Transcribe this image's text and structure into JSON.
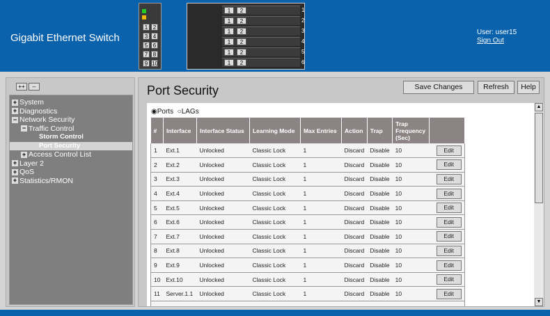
{
  "header": {
    "title": "Gigabit Ethernet Switch",
    "user_label": "User: user15",
    "sign_out": "Sign Out",
    "switch_ports": [
      "1",
      "2",
      "3",
      "4",
      "5",
      "6",
      "7",
      "8",
      "9",
      "10"
    ],
    "blade_slots": [
      {
        "p1": "1",
        "p2": "2",
        "num": "1"
      },
      {
        "p1": "1",
        "p2": "2",
        "num": "2"
      },
      {
        "p1": "1",
        "p2": "2",
        "num": "3"
      },
      {
        "p1": "1",
        "p2": "2",
        "num": "4"
      },
      {
        "p1": "1",
        "p2": "2",
        "num": "5"
      },
      {
        "p1": "1",
        "p2": "2",
        "num": "6"
      }
    ]
  },
  "sidebar": {
    "expand_all": "++",
    "collapse_all": "--",
    "items": [
      {
        "label": "System",
        "box": "+"
      },
      {
        "label": "Diagnostics",
        "box": "+"
      },
      {
        "label": "Network Security",
        "box": "−"
      },
      {
        "label": "Traffic Control",
        "box": "−"
      },
      {
        "label": "Storm Control"
      },
      {
        "label": "Port Security"
      },
      {
        "label": "Access Control List",
        "box": "+"
      },
      {
        "label": "Layer 2",
        "box": "+"
      },
      {
        "label": "QoS",
        "box": "+"
      },
      {
        "label": "Statistics/RMON",
        "box": "+"
      }
    ]
  },
  "main": {
    "title": "Port Security",
    "save": "Save Changes",
    "refresh": "Refresh",
    "help": "Help",
    "radio_ports": "Ports",
    "radio_lags": "LAGs",
    "columns": [
      "#",
      "Interface",
      "Interface Status",
      "Learning Mode",
      "Max Entries",
      "Action",
      "Trap",
      "Trap Frequency (Sec)",
      ""
    ],
    "edit_label": "Edit",
    "rows": [
      [
        "1",
        "Ext.1",
        "Unlocked",
        "Classic Lock",
        "1",
        "Discard",
        "Disable",
        "10"
      ],
      [
        "2",
        "Ext.2",
        "Unlocked",
        "Classic Lock",
        "1",
        "Discard",
        "Disable",
        "10"
      ],
      [
        "3",
        "Ext.3",
        "Unlocked",
        "Classic Lock",
        "1",
        "Discard",
        "Disable",
        "10"
      ],
      [
        "4",
        "Ext.4",
        "Unlocked",
        "Classic Lock",
        "1",
        "Discard",
        "Disable",
        "10"
      ],
      [
        "5",
        "Ext.5",
        "Unlocked",
        "Classic Lock",
        "1",
        "Discard",
        "Disable",
        "10"
      ],
      [
        "6",
        "Ext.6",
        "Unlocked",
        "Classic Lock",
        "1",
        "Discard",
        "Disable",
        "10"
      ],
      [
        "7",
        "Ext.7",
        "Unlocked",
        "Classic Lock",
        "1",
        "Discard",
        "Disable",
        "10"
      ],
      [
        "8",
        "Ext.8",
        "Unlocked",
        "Classic Lock",
        "1",
        "Discard",
        "Disable",
        "10"
      ],
      [
        "9",
        "Ext.9",
        "Unlocked",
        "Classic Lock",
        "1",
        "Discard",
        "Disable",
        "10"
      ],
      [
        "10",
        "Ext.10",
        "Unlocked",
        "Classic Lock",
        "1",
        "Discard",
        "Disable",
        "10"
      ],
      [
        "11",
        "Server.1.1",
        "Unlocked",
        "Classic Lock",
        "1",
        "Discard",
        "Disable",
        "10"
      ]
    ]
  }
}
